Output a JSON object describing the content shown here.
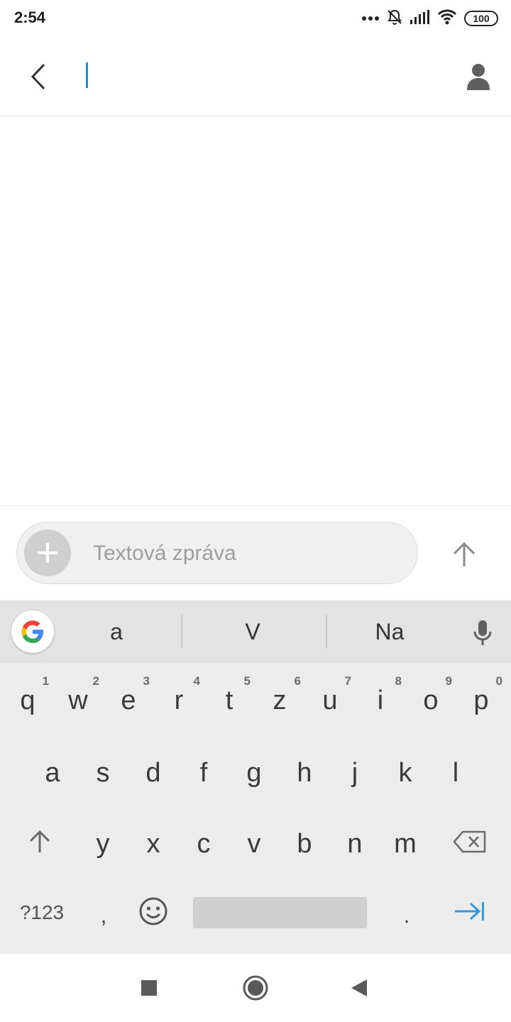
{
  "status_bar": {
    "time": "2:54",
    "battery": "100",
    "icons": [
      "more-dots-icon",
      "alarm-off-icon",
      "signal-icon",
      "wifi-icon",
      "battery-icon"
    ]
  },
  "header": {
    "back_icon": "chevron-left-icon",
    "contact_icon": "person-icon",
    "recipient_value": ""
  },
  "compose": {
    "placeholder": "Textová zpráva",
    "attach_icon": "plus-icon",
    "send_icon": "arrow-up-icon"
  },
  "keyboard": {
    "suggestions": [
      "a",
      "V",
      "Na"
    ],
    "row1": [
      {
        "key": "q",
        "hint": "1"
      },
      {
        "key": "w",
        "hint": "2"
      },
      {
        "key": "e",
        "hint": "3"
      },
      {
        "key": "r",
        "hint": "4"
      },
      {
        "key": "t",
        "hint": "5"
      },
      {
        "key": "z",
        "hint": "6"
      },
      {
        "key": "u",
        "hint": "7"
      },
      {
        "key": "i",
        "hint": "8"
      },
      {
        "key": "o",
        "hint": "9"
      },
      {
        "key": "p",
        "hint": "0"
      }
    ],
    "row2": [
      "a",
      "s",
      "d",
      "f",
      "g",
      "h",
      "j",
      "k",
      "l"
    ],
    "row3": [
      "y",
      "x",
      "c",
      "v",
      "b",
      "n",
      "m"
    ],
    "symbols_label": "?123",
    "comma": ",",
    "period": ".",
    "accent_color": "#2f9ae0"
  },
  "nav_bar": {
    "icons": [
      "recents-square-icon",
      "home-circle-icon",
      "back-triangle-icon"
    ]
  }
}
